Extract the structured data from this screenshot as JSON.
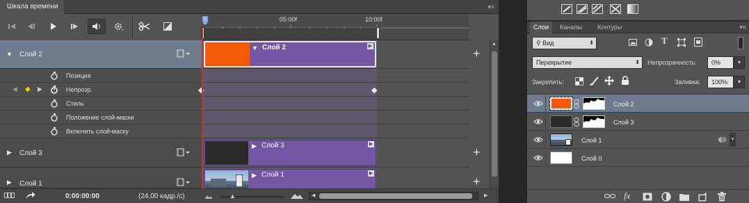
{
  "timeline": {
    "tab_label": "Шкала времени",
    "menu_icon": "panel-menu-icon",
    "ruler": {
      "tick1": "05:00f",
      "tick2": "10:00f"
    },
    "layers": [
      {
        "name": "Слой 2",
        "expanded": true,
        "selected": true,
        "clip_label": "Слой 2",
        "thumb_color": "#f25a0a"
      },
      {
        "name": "Слой 3",
        "expanded": false,
        "selected": false,
        "clip_label": "Слой 3",
        "thumb_color": "#2a2a2a"
      },
      {
        "name": "Слой 1",
        "expanded": false,
        "selected": false,
        "clip_label": "Слой 1",
        "thumb_color": "photo"
      }
    ],
    "properties": [
      "Позиция",
      "Непрозр.",
      "Стиль",
      "Положение слой-маски",
      "Включить слой-маску"
    ],
    "footer": {
      "timecode": "0:00:00:00",
      "fps": "(24,00 кадр./с)"
    }
  },
  "layers_panel": {
    "tabs": [
      "Слои",
      "Каналы",
      "Контуры"
    ],
    "filter_label": "Вид",
    "blend_mode": "Перекрытие",
    "opacity_label": "Непрозрачность:",
    "opacity_value": "0%",
    "lock_label": "Закрепить:",
    "fill_label": "Заливка:",
    "fill_value": "100%",
    "layers": [
      {
        "name": "Слой 2",
        "thumb_color": "#f25a0a",
        "has_mask": true,
        "selected": true
      },
      {
        "name": "Слой 3",
        "thumb_color": "#2a2a2a",
        "has_mask": true,
        "selected": false
      },
      {
        "name": "Слой 1",
        "thumb_color": "photo",
        "has_mask": false,
        "selected": false
      },
      {
        "name": "Слой 0",
        "thumb_color": "#ffffff",
        "has_mask": false,
        "selected": false
      }
    ]
  },
  "colors": {
    "accent_clip": "#7457a3",
    "selection_row": "#6f7c8f",
    "playhead": "#c0392b",
    "orange": "#f25a0a"
  }
}
